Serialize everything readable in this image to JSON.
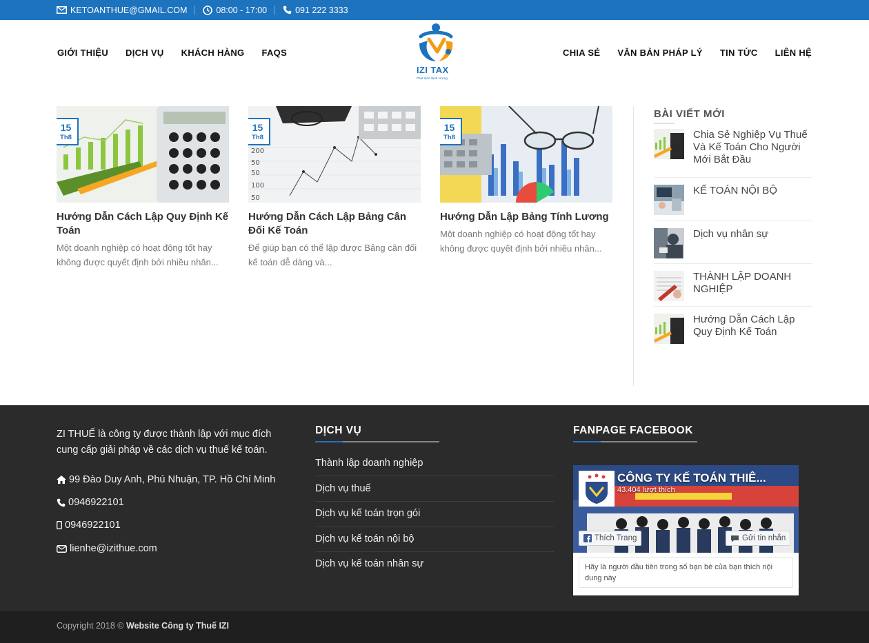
{
  "topbar": {
    "email": "KETOANTHUE@GMAIL.COM",
    "hours": "08:00 - 17:00",
    "phone": "091 222 3333",
    "icons": [
      "envelope-icon",
      "clock-icon",
      "phone-icon"
    ]
  },
  "nav": {
    "left": [
      "GIỚI THIỆU",
      "DỊCH VỤ",
      "KHÁCH HÀNG",
      "FAQS"
    ],
    "right": [
      "CHIA SẺ",
      "VĂN BẢN PHÁP LÝ",
      "TIN TỨC",
      "LIÊN HỆ"
    ]
  },
  "logo": {
    "brand": "IZI TAX",
    "tagline": "Phát triển thịnh vượng"
  },
  "posts": [
    {
      "day": "15",
      "month": "Th8",
      "title": "Hướng Dẫn Cách Lập Quy Định Kế Toán",
      "excerpt": "Một doanh nghiệp có hoạt động tốt hay không được quyết định bởi nhiều nhân..."
    },
    {
      "day": "15",
      "month": "Th8",
      "title": "Hướng Dẫn Cách Lập Bảng Cân Đối Kế Toán",
      "excerpt": "Để giúp bạn có thể lập được Bảng cân đối kế toán dễ dàng và..."
    },
    {
      "day": "15",
      "month": "Th8",
      "title": "Hướng Dẫn Lập Bảng Tính Lương",
      "excerpt": "Một doanh nghiệp có hoạt động tốt hay không được quyết định bởi nhiều nhân..."
    }
  ],
  "sidebar": {
    "heading": "BÀI VIẾT MỚI",
    "items": [
      "Chia Sẻ Nghiệp Vụ Thuế Và Kế Toán Cho Người Mới Bắt Đầu",
      "KẾ TOÁN NỘI BỘ",
      "Dịch vụ nhân sự",
      "THÀNH LẬP DOANH NGHIỆP",
      "Hướng Dẫn Cách Lập Quy Định Kế Toán"
    ]
  },
  "footer": {
    "about": "ZI THUẾ là công ty được thành lập với mục đích cung cấp giải pháp về các dịch vụ thuế kế toán.",
    "address": "99 Đào Duy Anh, Phú Nhuận, TP. Hồ Chí Minh",
    "phone": "0946922101",
    "mobile": "0946922101",
    "email": "lienhe@izithue.com",
    "services_heading": "DỊCH VỤ",
    "services": [
      "Thành lập doanh nghiệp",
      "Dịch vụ thuế",
      "Dịch vụ kế toán trọn gói",
      "Dịch vụ kế toán nội bộ",
      "Dịch vụ kế toán nhân sự"
    ],
    "fanpage_heading": "FANPAGE FACEBOOK",
    "fb": {
      "page_name": "CÔNG TY KẾ TOÁN THIÊ...",
      "likes": "43.404 lượt thích",
      "like_button": "Thích Trang",
      "message_button": "Gửi tin nhắn",
      "note": "Hãy là người đầu tiên trong số bạn bè của bạn thích nội dung này"
    },
    "copyright_prefix": "Copyright 2018 ©",
    "copyright_site": "Website Công ty Thuế IZI"
  },
  "colors": {
    "primary": "#1e73be",
    "footer_bg": "#2b2b2b",
    "bottom_bg": "#1f1f1f"
  }
}
